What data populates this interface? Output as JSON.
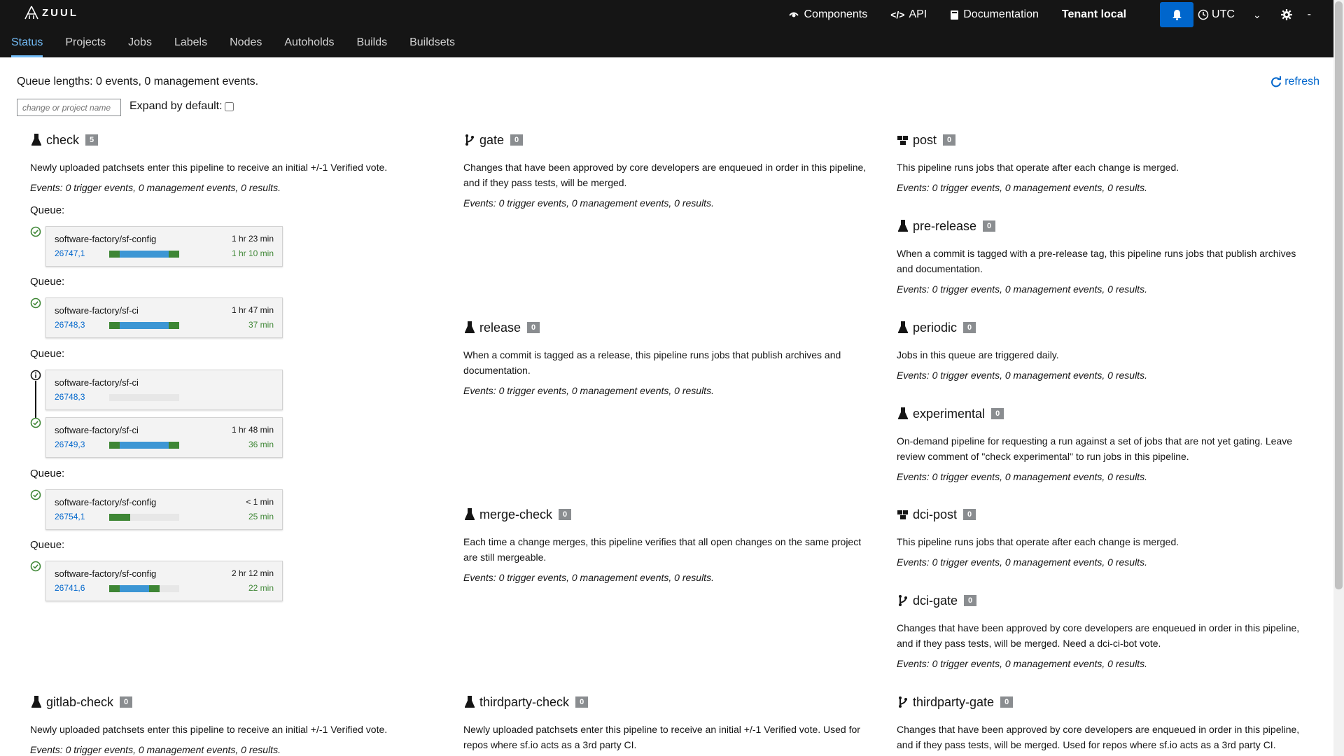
{
  "brand": {
    "name": "ZUUL"
  },
  "header": {
    "components": "Components",
    "api": "API",
    "documentation": "Documentation",
    "tenant": "Tenant local",
    "timezone": "UTC",
    "user": "-"
  },
  "nav": {
    "tabs": [
      "Status",
      "Projects",
      "Jobs",
      "Labels",
      "Nodes",
      "Autoholds",
      "Builds",
      "Buildsets"
    ],
    "active": "Status"
  },
  "status": {
    "queue_lengths": "Queue lengths: 0 events, 0 management events.",
    "refresh": "refresh",
    "filter_placeholder": "change or project name",
    "expand_label": "Expand by default:"
  },
  "colors": {
    "accent": "#0066cc",
    "success": "#3e8635",
    "progress_blue": "#3c96d4",
    "progress_green": "#3e8635",
    "masthead": "#151515"
  },
  "events_text": "Events: 0 trigger events, 0 management events, 0 results.",
  "queue_label": "Queue:",
  "pipelines": {
    "check": {
      "name": "check",
      "count": "5",
      "icon": "flask-icon",
      "desc": "Newly uploaded patchsets enter this pipeline to receive an initial +/-1 Verified vote."
    },
    "gate": {
      "name": "gate",
      "count": "0",
      "icon": "branch-icon",
      "desc": "Changes that have been approved by core developers are enqueued in order in this pipeline, and if they pass tests, will be merged."
    },
    "post": {
      "name": "post",
      "count": "0",
      "icon": "cubes-icon",
      "desc": "This pipeline runs jobs that operate after each change is merged."
    },
    "pre_release": {
      "name": "pre-release",
      "count": "0",
      "icon": "flask-icon",
      "desc": "When a commit is tagged with a pre-release tag, this pipeline runs jobs that publish archives and documentation."
    },
    "release": {
      "name": "release",
      "count": "0",
      "icon": "flask-icon",
      "desc": "When a commit is tagged as a release, this pipeline runs jobs that publish archives and documentation."
    },
    "periodic": {
      "name": "periodic",
      "count": "0",
      "icon": "flask-icon",
      "desc": "Jobs in this queue are triggered daily."
    },
    "experimental": {
      "name": "experimental",
      "count": "0",
      "icon": "flask-icon",
      "desc": "On-demand pipeline for requesting a run against a set of jobs that are not yet gating. Leave review comment of \"check experimental\" to run jobs in this pipeline."
    },
    "merge_check": {
      "name": "merge-check",
      "count": "0",
      "icon": "flask-icon",
      "desc": "Each time a change merges, this pipeline verifies that all open changes on the same project are still mergeable."
    },
    "dci_post": {
      "name": "dci-post",
      "count": "0",
      "icon": "cubes-icon",
      "desc": "This pipeline runs jobs that operate after each change is merged."
    },
    "dci_gate": {
      "name": "dci-gate",
      "count": "0",
      "icon": "branch-icon",
      "desc": "Changes that have been approved by core developers are enqueued in order in this pipeline, and if they pass tests, will be merged. Need a dci-ci-bot vote."
    },
    "gitlab_check": {
      "name": "gitlab-check",
      "count": "0",
      "icon": "flask-icon",
      "desc": "Newly uploaded patchsets enter this pipeline to receive an initial +/-1 Verified vote."
    },
    "thirdparty_check": {
      "name": "thirdparty-check",
      "count": "0",
      "icon": "flask-icon",
      "desc": "Newly uploaded patchsets enter this pipeline to receive an initial +/-1 Verified vote. Used for repos where sf.io acts as a 3rd party CI."
    },
    "thirdparty_gate": {
      "name": "thirdparty-gate",
      "count": "0",
      "icon": "branch-icon",
      "desc": "Changes that have been approved by core developers are enqueued in order in this pipeline, and if they pass tests, will be merged. Used for repos where sf.io acts as a 3rd party CI."
    }
  },
  "check_changes": [
    {
      "project": "software-factory/sf-config",
      "change": "26747,1",
      "elapsed": "1 hr 23 min",
      "remaining": "1 hr 10 min",
      "status": "success",
      "progress": [
        [
          "green",
          0.15
        ],
        [
          "blue",
          0.7
        ],
        [
          "green",
          0.15
        ]
      ]
    },
    {
      "project": "software-factory/sf-ci",
      "change": "26748,3",
      "elapsed": "1 hr 47 min",
      "remaining": "37 min",
      "status": "success",
      "progress": [
        [
          "green",
          0.15
        ],
        [
          "blue",
          0.7
        ],
        [
          "green",
          0.15
        ]
      ]
    },
    {
      "project": "software-factory/sf-ci",
      "change": "26748,3",
      "elapsed": "",
      "remaining": "",
      "status": "info",
      "progress": []
    },
    {
      "project": "software-factory/sf-ci",
      "change": "26749,3",
      "elapsed": "1 hr 48 min",
      "remaining": "36 min",
      "status": "success",
      "progress": [
        [
          "green",
          0.15
        ],
        [
          "blue",
          0.7
        ],
        [
          "green",
          0.15
        ]
      ]
    },
    {
      "project": "software-factory/sf-config",
      "change": "26754,1",
      "elapsed": "< 1 min",
      "remaining": "25 min",
      "status": "success",
      "progress": [
        [
          "green",
          0.3
        ]
      ]
    },
    {
      "project": "software-factory/sf-config",
      "change": "26741,6",
      "elapsed": "2 hr 12 min",
      "remaining": "22 min",
      "status": "success",
      "progress": [
        [
          "green",
          0.15
        ],
        [
          "blue",
          0.42
        ],
        [
          "green",
          0.15
        ]
      ]
    }
  ]
}
